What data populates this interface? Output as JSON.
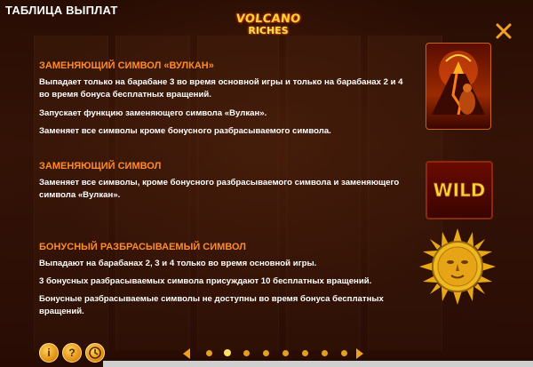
{
  "header": {
    "title": "ТАБЛИЦА ВЫПЛАТ",
    "logo_line1": "VOLCANO",
    "logo_line2": "RICHES"
  },
  "sections": [
    {
      "title": "ЗАМЕНЯЮЩИЙ СИМВОЛ «ВУЛКАН»",
      "lines": [
        "Выпадает только на барабане 3 во время основной игры и только на барабанах 2 и 4 во время бонуса бесплатных вращений.",
        "Запускает функцию заменяющего символа «Вулкан».",
        "Заменяет все символы кроме бонусного разбрасываемого символа."
      ],
      "icon": "volcano-wild-symbol"
    },
    {
      "title": "ЗАМЕНЯЮЩИЙ СИМВОЛ",
      "lines": [
        "Заменяет все символы, кроме бонусного разбрасываемого символа и заменяющего символа «Вулкан»."
      ],
      "icon": "wild-symbol",
      "icon_text": "WILD"
    },
    {
      "title": "БОНУСНЫЙ РАЗБРАСЫВАЕМЫЙ СИМВОЛ",
      "lines": [
        "Выпадают на барабанах 2, 3 и 4 только во время основной игры.",
        "3 бонусных разбрасываемых символа присуждают 10 бесплатных вращений.",
        "Бонусные разбрасываемые символы не доступны во время бонуса бесплатных вращений."
      ],
      "icon": "sun-scatter-symbol"
    }
  ],
  "footer": {
    "buttons": [
      {
        "name": "info-button",
        "glyph": "i"
      },
      {
        "name": "help-button",
        "glyph": "?"
      },
      {
        "name": "history-button",
        "glyph": ""
      }
    ],
    "pages": 8,
    "active_page": 1
  },
  "colors": {
    "section_title": "#ff8a2a",
    "body_text": "#ffffff",
    "accent_gold": "#ffd23a"
  }
}
